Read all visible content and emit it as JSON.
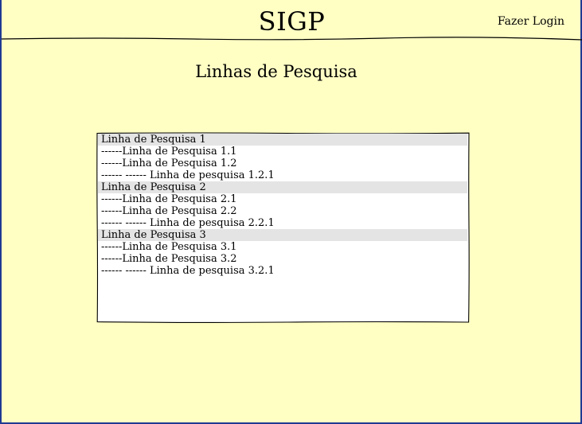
{
  "header": {
    "title": "SIGP",
    "login_label": "Fazer Login"
  },
  "main": {
    "title": "Linhas de Pesquisa",
    "items": [
      {
        "label": "Linha de Pesquisa 1",
        "level": 0
      },
      {
        "label": "------Linha de Pesquisa 1.1",
        "level": 1
      },
      {
        "label": "------Linha de Pesquisa 1.2",
        "level": 1
      },
      {
        "label": "------ ------ Linha de pesquisa 1.2.1",
        "level": 2
      },
      {
        "label": "Linha de Pesquisa 2",
        "level": 0
      },
      {
        "label": "------Linha de Pesquisa 2.1",
        "level": 1
      },
      {
        "label": "------Linha de Pesquisa 2.2",
        "level": 1
      },
      {
        "label": "------ ------ Linha de pesquisa 2.2.1",
        "level": 2
      },
      {
        "label": "Linha de Pesquisa 3",
        "level": 0
      },
      {
        "label": "------Linha de Pesquisa 3.1",
        "level": 1
      },
      {
        "label": "------Linha de Pesquisa 3.2",
        "level": 1
      },
      {
        "label": "------ ------ Linha de pesquisa 3.2.1",
        "level": 2
      }
    ]
  },
  "colors": {
    "background": "#ffffc4",
    "group_row": "#e4e4e4",
    "border": "#1f3a93"
  }
}
